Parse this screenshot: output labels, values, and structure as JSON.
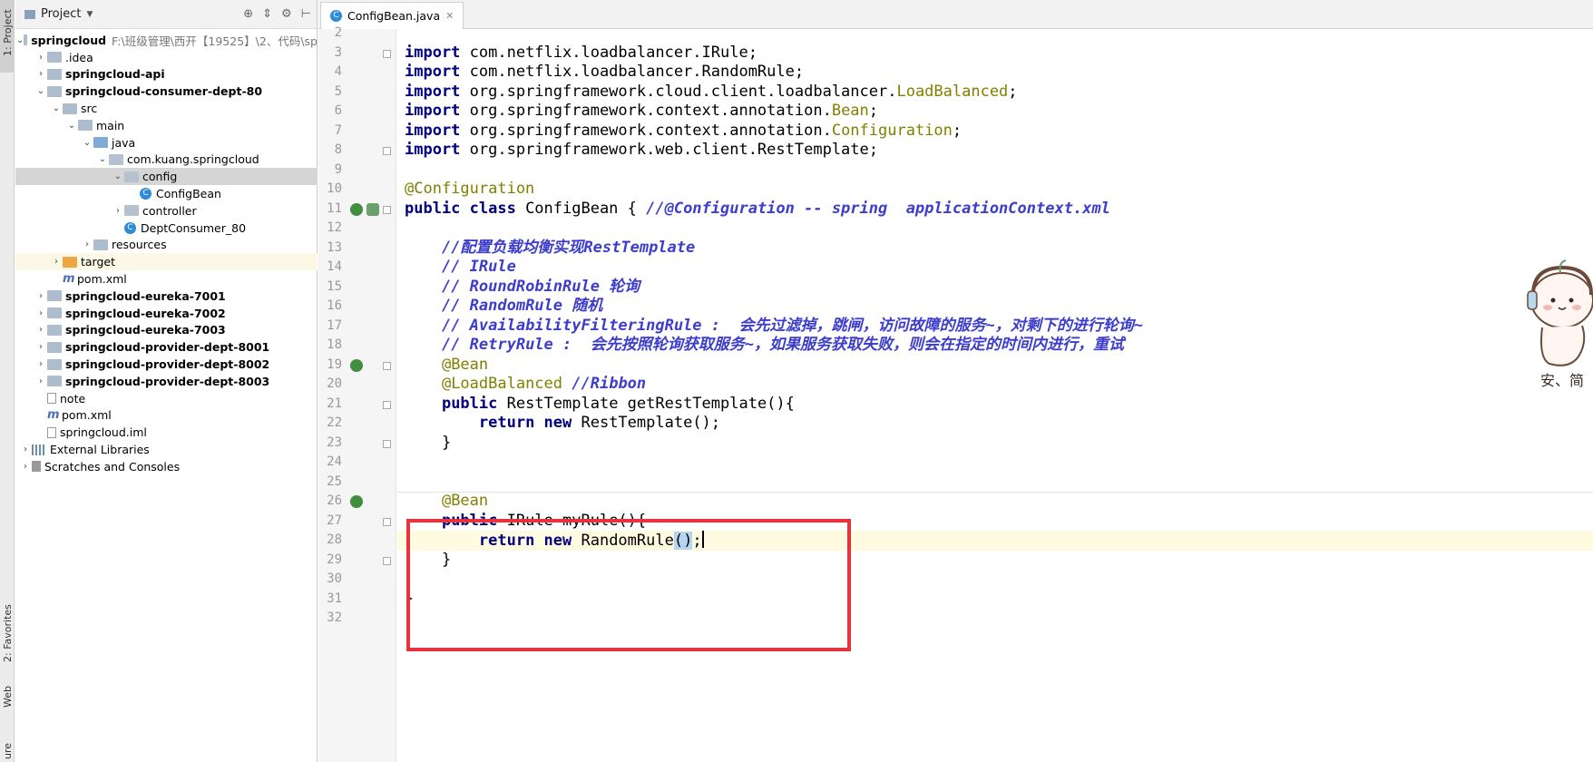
{
  "toolstrip": {
    "project_tab": "1: Project",
    "favorites_tab": "2: Favorites",
    "web_tab": "Web",
    "structure_tab": "ure"
  },
  "project_panel": {
    "title": "Project",
    "root_path": "F:\\班级管理\\西开【19525】\\2、代码\\sp",
    "tree": [
      {
        "label": "springcloud",
        "bold": true,
        "depth": 0,
        "expanded": true,
        "type": "folder"
      },
      {
        "label": ".idea",
        "bold": false,
        "depth": 1,
        "expanded": false,
        "type": "folder"
      },
      {
        "label": "springcloud-api",
        "bold": true,
        "depth": 1,
        "expanded": false,
        "type": "folder"
      },
      {
        "label": "springcloud-consumer-dept-80",
        "bold": true,
        "depth": 1,
        "expanded": true,
        "type": "folder"
      },
      {
        "label": "src",
        "bold": false,
        "depth": 2,
        "expanded": true,
        "type": "folder"
      },
      {
        "label": "main",
        "bold": false,
        "depth": 3,
        "expanded": true,
        "type": "folder"
      },
      {
        "label": "java",
        "bold": false,
        "depth": 4,
        "expanded": true,
        "type": "folder-blue"
      },
      {
        "label": "com.kuang.springcloud",
        "bold": false,
        "depth": 5,
        "expanded": true,
        "type": "package"
      },
      {
        "label": "config",
        "bold": false,
        "depth": 6,
        "expanded": true,
        "type": "package",
        "selected": true
      },
      {
        "label": "ConfigBean",
        "bold": false,
        "depth": 7,
        "type": "class"
      },
      {
        "label": "controller",
        "bold": false,
        "depth": 6,
        "expanded": false,
        "type": "package"
      },
      {
        "label": "DeptConsumer_80",
        "bold": false,
        "depth": 6,
        "type": "class"
      },
      {
        "label": "resources",
        "bold": false,
        "depth": 4,
        "expanded": false,
        "type": "folder"
      },
      {
        "label": "target",
        "bold": false,
        "depth": 2,
        "expanded": false,
        "type": "folder-orange",
        "highlight": true
      },
      {
        "label": "pom.xml",
        "bold": false,
        "depth": 2,
        "type": "maven"
      },
      {
        "label": "springcloud-eureka-7001",
        "bold": true,
        "depth": 1,
        "expanded": false,
        "type": "folder"
      },
      {
        "label": "springcloud-eureka-7002",
        "bold": true,
        "depth": 1,
        "expanded": false,
        "type": "folder"
      },
      {
        "label": "springcloud-eureka-7003",
        "bold": true,
        "depth": 1,
        "expanded": false,
        "type": "folder"
      },
      {
        "label": "springcloud-provider-dept-8001",
        "bold": true,
        "depth": 1,
        "expanded": false,
        "type": "folder"
      },
      {
        "label": "springcloud-provider-dept-8002",
        "bold": true,
        "depth": 1,
        "expanded": false,
        "type": "folder"
      },
      {
        "label": "springcloud-provider-dept-8003",
        "bold": true,
        "depth": 1,
        "expanded": false,
        "type": "folder"
      },
      {
        "label": "note",
        "bold": false,
        "depth": 1,
        "type": "file"
      },
      {
        "label": "pom.xml",
        "bold": false,
        "depth": 1,
        "type": "maven"
      },
      {
        "label": "springcloud.iml",
        "bold": false,
        "depth": 1,
        "type": "file"
      },
      {
        "label": "External Libraries",
        "bold": false,
        "depth": 0,
        "expanded": false,
        "type": "library"
      },
      {
        "label": "Scratches and Consoles",
        "bold": false,
        "depth": 0,
        "expanded": false,
        "type": "scratch"
      }
    ]
  },
  "editor": {
    "tab_label": "ConfigBean.java",
    "caret_line": 28,
    "lines": [
      {
        "n": "2",
        "segs": []
      },
      {
        "n": "3",
        "segs": [
          [
            "kw",
            "import"
          ],
          [
            "",
            "com.netflix.loadbalancer.IRule;"
          ]
        ]
      },
      {
        "n": "4",
        "segs": [
          [
            "kw",
            "import"
          ],
          [
            "",
            "com.netflix.loadbalancer.RandomRule;"
          ]
        ]
      },
      {
        "n": "5",
        "segs": [
          [
            "kw",
            "import"
          ],
          [
            "",
            "org.springframework.cloud.client.loadbalancer."
          ],
          [
            "ann",
            "LoadBalanced"
          ],
          [
            "",
            ";"
          ]
        ]
      },
      {
        "n": "6",
        "segs": [
          [
            "kw",
            "import"
          ],
          [
            "",
            "org.springframework.context.annotation."
          ],
          [
            "ann",
            "Bean"
          ],
          [
            "",
            ";"
          ]
        ]
      },
      {
        "n": "7",
        "segs": [
          [
            "kw",
            "import"
          ],
          [
            "",
            "org.springframework.context.annotation."
          ],
          [
            "ann",
            "Configuration"
          ],
          [
            "",
            ";"
          ]
        ]
      },
      {
        "n": "8",
        "segs": [
          [
            "kw",
            "import"
          ],
          [
            "",
            "org.springframework.web.client.RestTemplate;"
          ]
        ]
      },
      {
        "n": "9",
        "segs": []
      },
      {
        "n": "10",
        "segs": [
          [
            "ann",
            "@Configuration"
          ]
        ]
      },
      {
        "n": "11",
        "segs": [
          [
            "kw",
            "public class"
          ],
          [
            "",
            " ConfigBean { "
          ],
          [
            "cmb",
            "//@Configuration -- spring  applicationContext.xml"
          ]
        ]
      },
      {
        "n": "12",
        "segs": []
      },
      {
        "n": "13",
        "segs": [
          [
            "",
            "    "
          ],
          [
            "cmb",
            "//配置负载均衡实现RestTemplate"
          ]
        ]
      },
      {
        "n": "14",
        "segs": [
          [
            "",
            "    "
          ],
          [
            "cmb",
            "// IRule"
          ]
        ]
      },
      {
        "n": "15",
        "segs": [
          [
            "",
            "    "
          ],
          [
            "cmb",
            "// RoundRobinRule 轮询"
          ]
        ]
      },
      {
        "n": "16",
        "segs": [
          [
            "",
            "    "
          ],
          [
            "cmb",
            "// RandomRule 随机"
          ]
        ]
      },
      {
        "n": "17",
        "segs": [
          [
            "",
            "    "
          ],
          [
            "cmb",
            "// AvailabilityFilteringRule :  会先过滤掉，跳闸，访问故障的服务~，对剩下的进行轮询~"
          ]
        ]
      },
      {
        "n": "18",
        "segs": [
          [
            "",
            "    "
          ],
          [
            "cmb",
            "// RetryRule :  会先按照轮询获取服务~，如果服务获取失败，则会在指定的时间内进行，重试"
          ]
        ]
      },
      {
        "n": "19",
        "segs": [
          [
            "",
            "    "
          ],
          [
            "ann",
            "@Bean"
          ]
        ]
      },
      {
        "n": "20",
        "segs": [
          [
            "",
            "    "
          ],
          [
            "ann",
            "@LoadBalanced"
          ],
          [
            "",
            " "
          ],
          [
            "cmb",
            "//Ribbon"
          ]
        ]
      },
      {
        "n": "21",
        "segs": [
          [
            "",
            "    "
          ],
          [
            "kw",
            "public"
          ],
          [
            "",
            " RestTemplate getRestTemplate(){"
          ]
        ]
      },
      {
        "n": "22",
        "segs": [
          [
            "",
            "        "
          ],
          [
            "kw",
            "return new"
          ],
          [
            "",
            " RestTemplate();"
          ]
        ]
      },
      {
        "n": "23",
        "segs": [
          [
            "",
            "    }"
          ]
        ]
      },
      {
        "n": "24",
        "segs": []
      },
      {
        "n": "25",
        "segs": []
      },
      {
        "n": "26",
        "segs": [
          [
            "",
            "    "
          ],
          [
            "ann",
            "@Bean"
          ]
        ]
      },
      {
        "n": "27",
        "segs": [
          [
            "",
            "    "
          ],
          [
            "kw",
            "public"
          ],
          [
            "",
            " IRule myRule(){"
          ]
        ]
      },
      {
        "n": "28",
        "segs": [
          [
            "",
            "        "
          ],
          [
            "kw",
            "return new"
          ],
          [
            "",
            " RandomRule"
          ],
          [
            "paren",
            "()"
          ],
          [
            "",
            ";"
          ],
          [
            "caret",
            ""
          ]
        ]
      },
      {
        "n": "29",
        "segs": [
          [
            "",
            "    }"
          ]
        ]
      },
      {
        "n": "30",
        "segs": []
      },
      {
        "n": "31",
        "segs": [
          [
            "",
            "}"
          ]
        ]
      },
      {
        "n": "32",
        "segs": []
      }
    ]
  },
  "sticker": {
    "caption": "安、简"
  },
  "colors": {
    "highlight_box": "#e8323c",
    "keyword": "#000080",
    "annotation": "#808000",
    "comment": "#3d3dcc"
  }
}
